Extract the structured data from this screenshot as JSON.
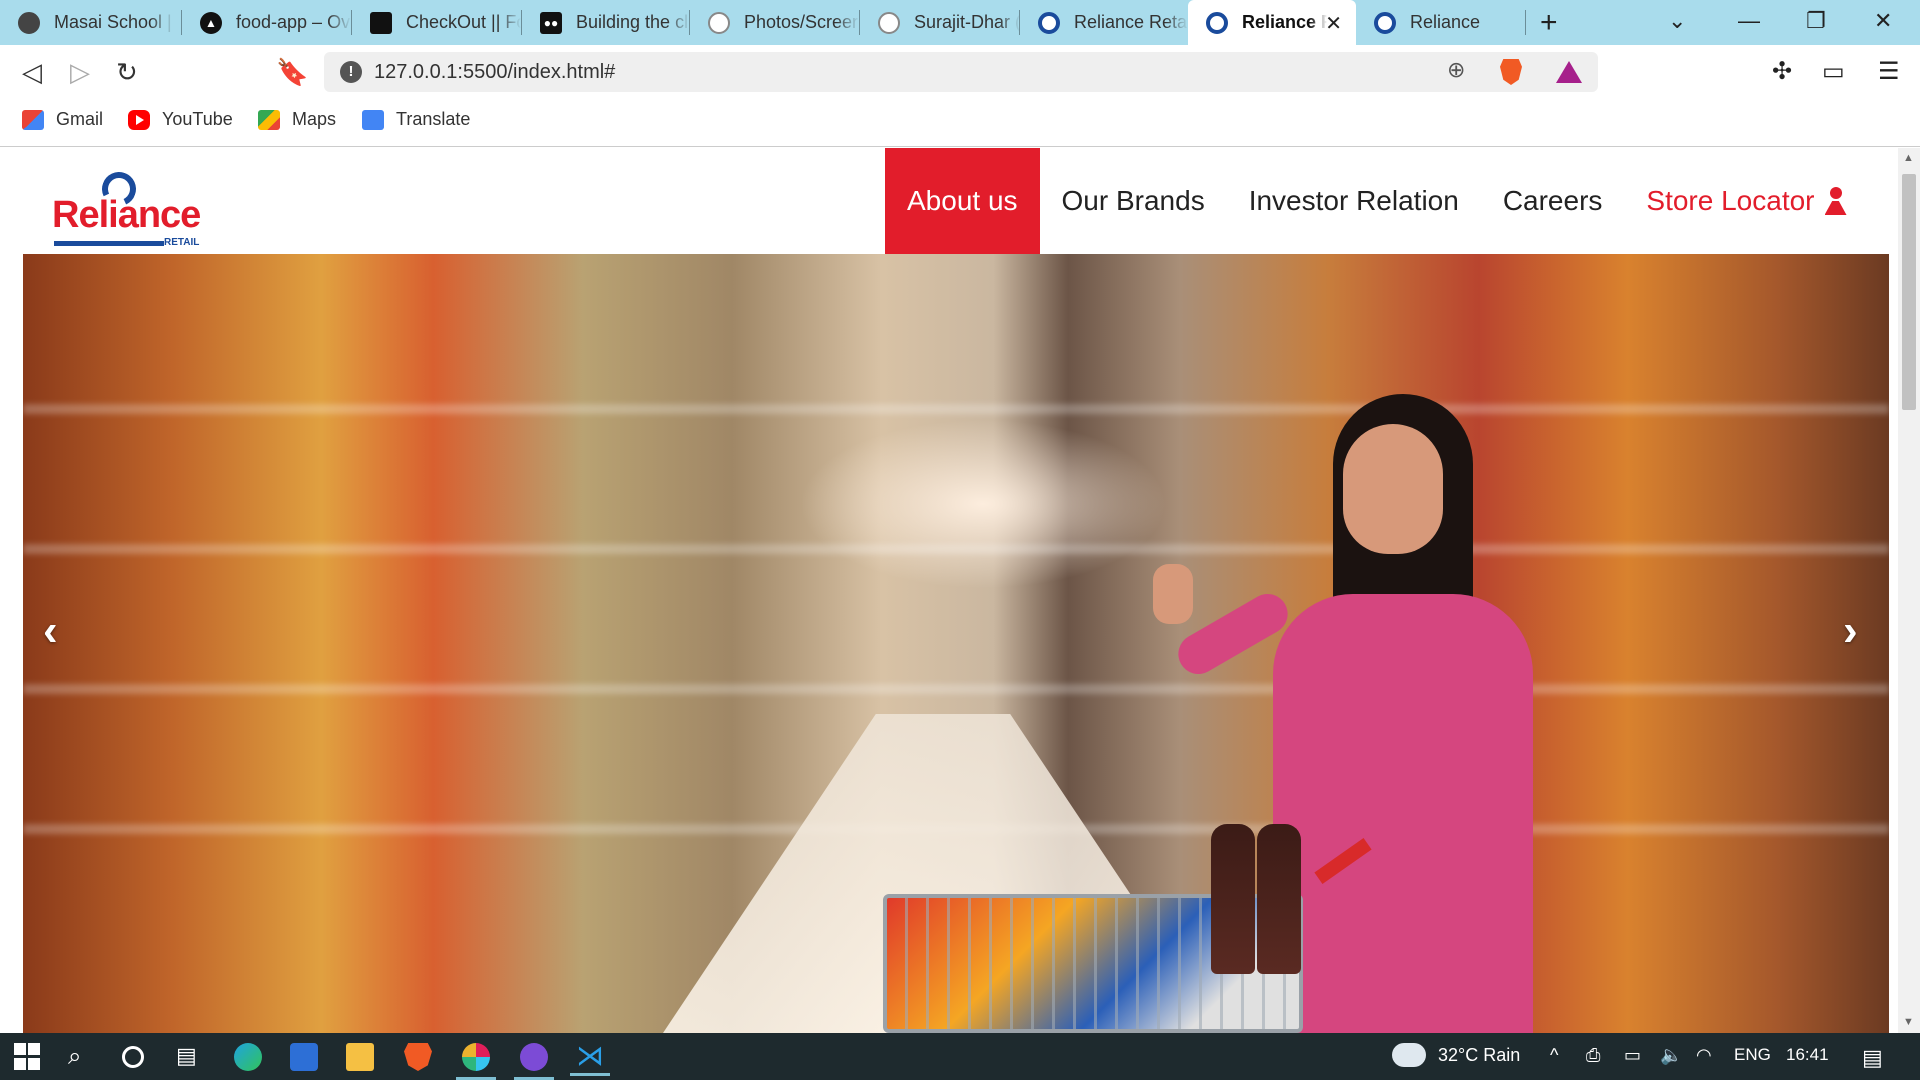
{
  "browser": {
    "tabs": [
      {
        "title": "Masai School |",
        "icon": "globe-icon"
      },
      {
        "title": "food-app – Ov",
        "icon": "triangle-logo-icon"
      },
      {
        "title": "CheckOut || Fo",
        "icon": "food-logo-icon"
      },
      {
        "title": "Building the cl",
        "icon": "medium-logo-icon"
      },
      {
        "title": "Photos/Screer",
        "icon": "github-icon"
      },
      {
        "title": "Surajit-Dhar (S",
        "icon": "github-icon"
      },
      {
        "title": "Reliance Retail",
        "icon": "reliance-logo-icon"
      },
      {
        "title": "Reliance R",
        "icon": "reliance-logo-icon",
        "active": true
      },
      {
        "title": "Reliance",
        "icon": "reliance-logo-icon"
      }
    ],
    "url": "127.0.0.1:5500/index.html#",
    "bookmarks": [
      {
        "label": "Gmail",
        "icon": "gmail-icon"
      },
      {
        "label": "YouTube",
        "icon": "youtube-icon"
      },
      {
        "label": "Maps",
        "icon": "maps-icon"
      },
      {
        "label": "Translate",
        "icon": "translate-icon"
      }
    ]
  },
  "site": {
    "logo_word": "Reliance",
    "logo_sub": "RETAIL",
    "nav": [
      {
        "label": "About us",
        "active": true
      },
      {
        "label": "Our Brands"
      },
      {
        "label": "Investor Relation"
      },
      {
        "label": "Careers"
      },
      {
        "label": "Store Locator",
        "icon": "person-pin-icon"
      }
    ],
    "colors": {
      "brand_red": "#e21d2b",
      "brand_blue": "#1a4b9c"
    },
    "carousel": {
      "prev": "‹",
      "next": "›"
    }
  },
  "taskbar": {
    "weather": "32°C  Rain",
    "language": "ENG",
    "time": "16:41"
  }
}
